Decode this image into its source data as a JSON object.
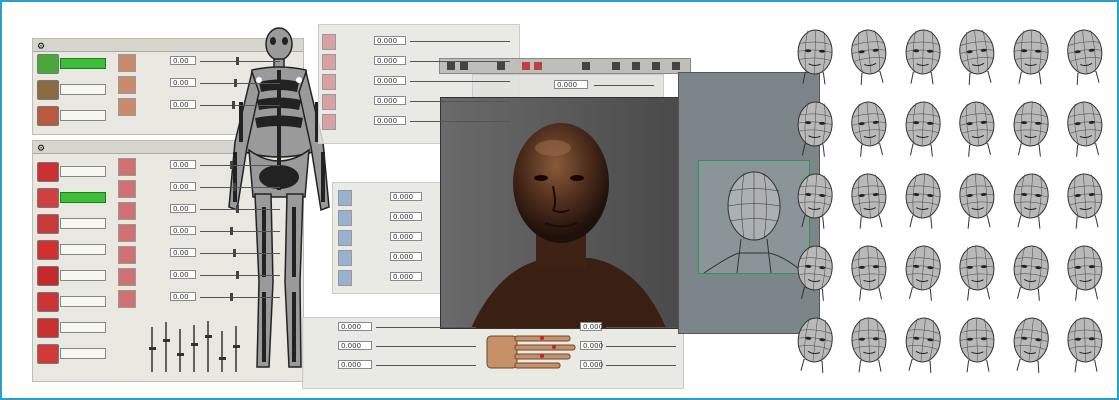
{
  "window": {
    "border_color": "#2aa0c8"
  },
  "top_panel": {
    "title": "",
    "items": [
      {
        "tag": "",
        "active": true,
        "color": "#5bbd3d"
      },
      {
        "tag": "",
        "active": false,
        "color": "#8a6a40"
      },
      {
        "tag": "",
        "active": false,
        "color": "#b85a40"
      }
    ],
    "rows": [
      {
        "label": "",
        "value": "0.00"
      },
      {
        "label": "",
        "value": "0.00"
      },
      {
        "label": "",
        "value": "0.00"
      }
    ]
  },
  "bottom_panel": {
    "title": "",
    "items": [
      {
        "tag": "",
        "active": false
      },
      {
        "tag": "",
        "active": true
      },
      {
        "tag": "",
        "active": false
      },
      {
        "tag": "",
        "active": false
      },
      {
        "tag": "",
        "active": false
      },
      {
        "tag": "",
        "active": false
      },
      {
        "tag": "",
        "active": false
      },
      {
        "tag": "",
        "active": false
      }
    ],
    "rows": [
      {
        "label": "",
        "value": "0.00"
      },
      {
        "label": "",
        "value": "0.00"
      },
      {
        "label": "",
        "value": "0.00"
      },
      {
        "label": "",
        "value": "0.00"
      },
      {
        "label": "",
        "value": "0.00"
      },
      {
        "label": "",
        "value": "0.00"
      },
      {
        "label": "",
        "value": "0.00"
      }
    ]
  },
  "mid_panel_top": {
    "rows": [
      {
        "label": "",
        "value": "0.000"
      },
      {
        "label": "",
        "value": "0.000"
      },
      {
        "label": "",
        "value": "0.000"
      },
      {
        "label": "",
        "value": "0.000"
      },
      {
        "label": "",
        "value": "0.000"
      }
    ]
  },
  "mid_panel_mid": {
    "rows": [
      {
        "label": "",
        "value": "0.000"
      },
      {
        "label": "",
        "value": "0.000"
      },
      {
        "label": "",
        "value": "0.000"
      },
      {
        "label": "",
        "value": "0.000"
      },
      {
        "label": "",
        "value": "0.000"
      }
    ]
  },
  "mid_panel_bottom": {
    "rows": [
      {
        "label": "",
        "value": "0.000"
      },
      {
        "label": "",
        "value": "0.000"
      },
      {
        "label": "",
        "value": "0.000"
      }
    ]
  },
  "viewport": {
    "field_label": "",
    "field_value": "0.000"
  },
  "heads_grid": {
    "rows": 5,
    "cols": 6
  }
}
